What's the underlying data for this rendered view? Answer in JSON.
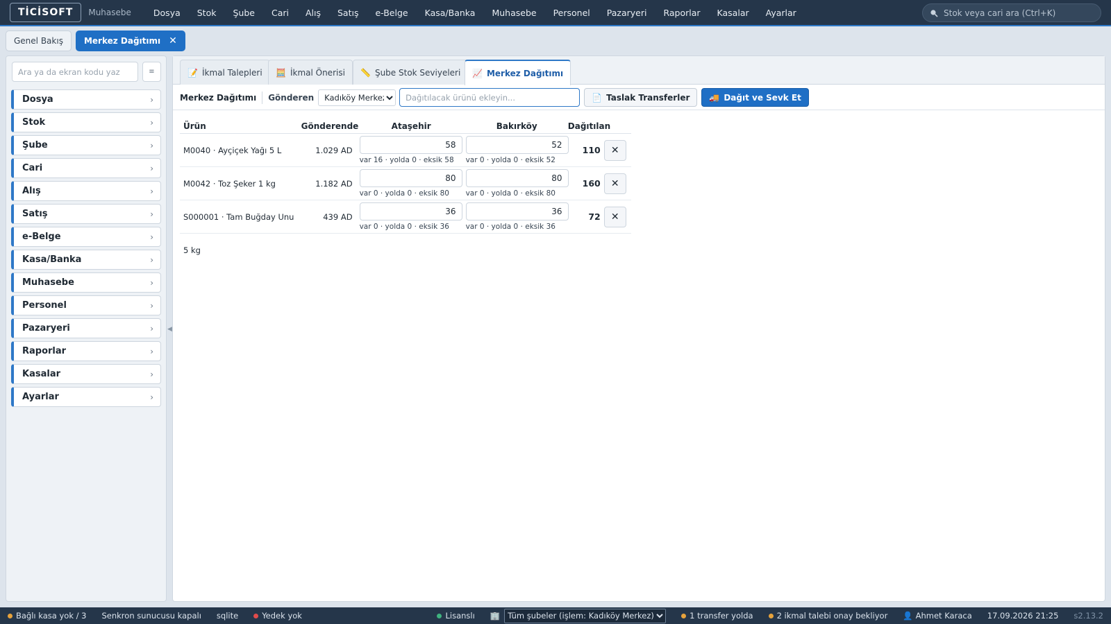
{
  "app": {
    "logo": "TİCİSOFT",
    "subtitle": "Muhasebe"
  },
  "topmenu": [
    "Dosya",
    "Stok",
    "Şube",
    "Cari",
    "Alış",
    "Satış",
    "e-Belge",
    "Kasa/Banka",
    "Muhasebe",
    "Personel",
    "Pazaryeri",
    "Raporlar",
    "Kasalar",
    "Ayarlar"
  ],
  "global_search": {
    "placeholder": "Stok veya cari ara (Ctrl+K)"
  },
  "page_tabs": {
    "overview": "Genel Bakış",
    "active": "Merkez Dağıtımı"
  },
  "sidebar": {
    "search_placeholder": "Ara ya da ekran kodu yaz",
    "items": [
      "Dosya",
      "Stok",
      "Şube",
      "Cari",
      "Alış",
      "Satış",
      "e-Belge",
      "Kasa/Banka",
      "Muhasebe",
      "Personel",
      "Pazaryeri",
      "Raporlar",
      "Kasalar",
      "Ayarlar"
    ]
  },
  "subtabs": [
    "İkmal Talepleri",
    "İkmal Önerisi",
    "Şube Stok Seviyeleri",
    "Merkez Dağıtımı"
  ],
  "toolbar": {
    "title": "Merkez Dağıtımı",
    "sender_label": "Gönderen",
    "sender_value": "Kadıköy Merkez",
    "product_placeholder": "Dağıtılacak ürünü ekleyin...",
    "draft_button": "Taslak Transferler",
    "ship_button": "Dağıt ve Sevk Et"
  },
  "table": {
    "headers": {
      "product": "Ürün",
      "at_sender": "Gönderende",
      "branch1": "Ataşehir",
      "branch2": "Bakırköy",
      "distributed": "Dağıtılan"
    },
    "rows": [
      {
        "product": "M0040 · Ayçiçek Yağı 5 L",
        "at_sender": "1.029 AD",
        "b1_qty": "58",
        "b1_hint": "var 16 · yolda 0 · eksik 58",
        "b2_qty": "52",
        "b2_hint": "var 0 · yolda 0 · eksik 52",
        "distributed": "110"
      },
      {
        "product": "M0042 · Toz Şeker 1 kg",
        "at_sender": "1.182 AD",
        "b1_qty": "80",
        "b1_hint": "var 0 · yolda 0 · eksik 80",
        "b2_qty": "80",
        "b2_hint": "var 0 · yolda 0 · eksik 80",
        "distributed": "160"
      },
      {
        "product": "S000001 · Tam Buğday Unu 5 kg",
        "at_sender": "439 AD",
        "b1_qty": "36",
        "b1_hint": "var 0 · yolda 0 · eksik 36",
        "b2_qty": "36",
        "b2_hint": "var 0 · yolda 0 · eksik 36",
        "distributed": "72"
      }
    ]
  },
  "status": {
    "register": "Bağlı kasa yok / 3",
    "sync": "Senkron sunucusu kapalı",
    "db": "sqlite",
    "backup": "Yedek yok",
    "license": "Lisanslı",
    "branch_select": "Tüm şubeler (işlem: Kadıköy Merkez)",
    "transfer": "1 transfer yolda",
    "requests": "2 ikmal talebi onay bekliyor",
    "user": "Ahmet Karaca",
    "datetime": "17.09.2026 21:25",
    "version": "s2.13.2"
  },
  "colors": {
    "accent": "#1f6fc5",
    "topbar": "#25364a",
    "warn": "#e6a23c",
    "danger": "#e04b4b",
    "ok": "#3fb37f"
  }
}
